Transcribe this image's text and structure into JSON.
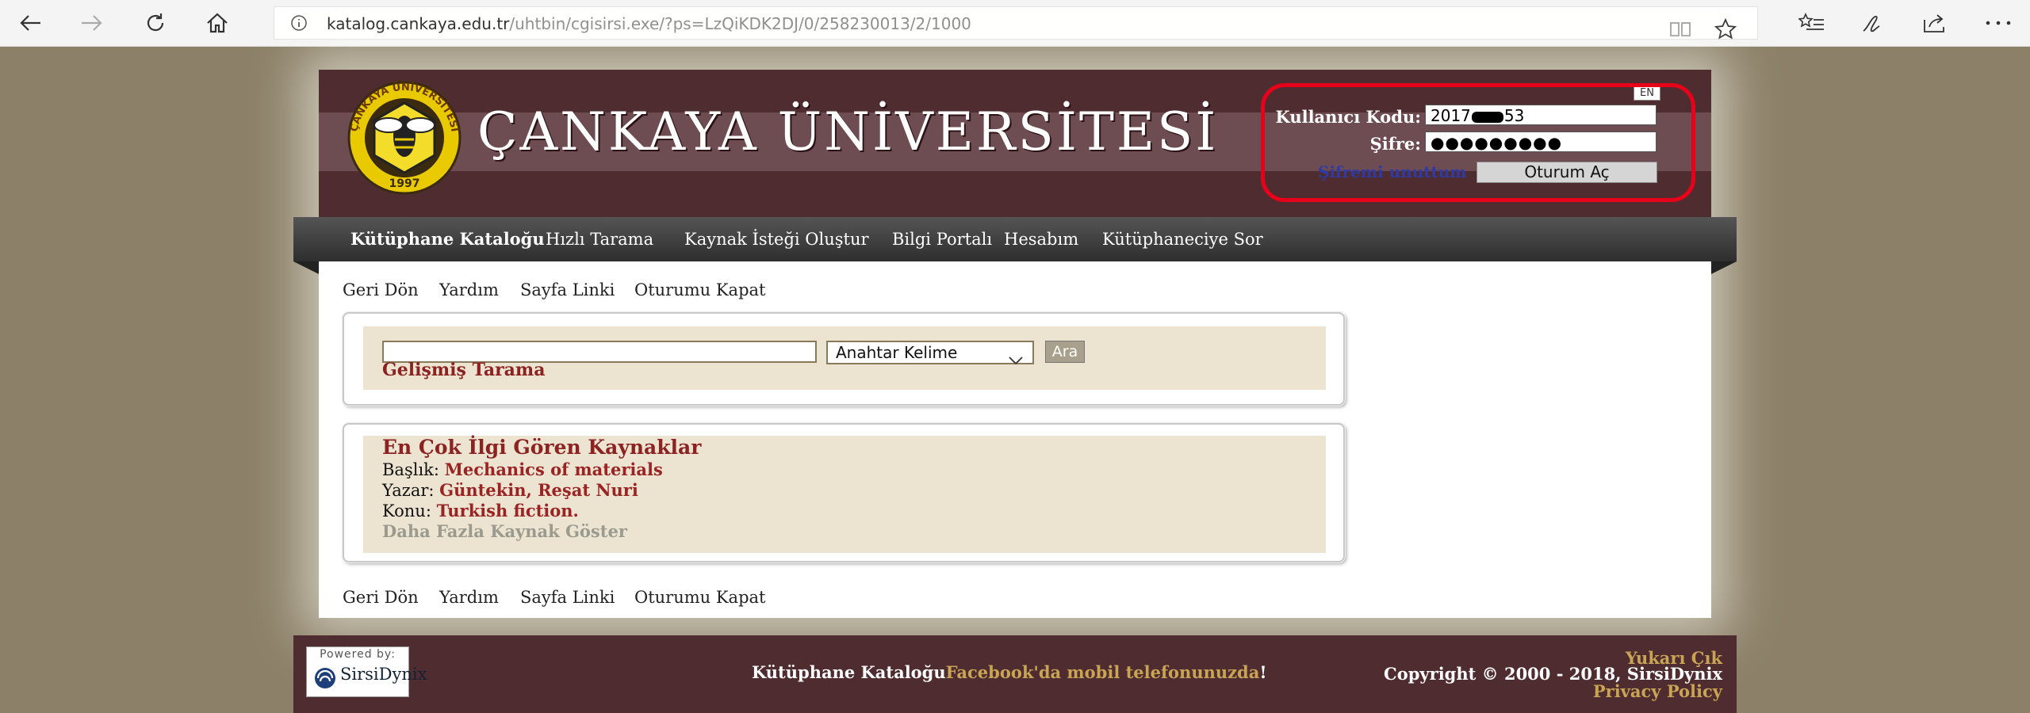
{
  "browser": {
    "url_host": "katalog.cankaya.edu.tr",
    "url_path": "/uhtbin/cgisirsi.exe/?ps=LzQiKDK2DJ/0/258230013/2/1000"
  },
  "header": {
    "title": "ÇANKAYA ÜNİVERSİTESİ",
    "logo_top_text": "ÇANKAYA ÜNİVERSİTESİ",
    "logo_year": "1997",
    "lang_button": "EN",
    "user_label": "Kullanıcı Kodu:",
    "user_value": "2017",
    "user_value_tail": "53",
    "password_label": "Şifre:",
    "password_value": "●●●●●●●●●",
    "forgot_link": "Şifremi unuttum",
    "login_button": "Oturum Aç"
  },
  "nav": {
    "items": [
      "Kütüphane Kataloğu",
      "Hızlı Tarama",
      "Kaynak İsteği Oluştur",
      "Bilgi Portalı",
      "Hesabım",
      "Kütüphaneciye Sor"
    ]
  },
  "toplinks": [
    "Geri Dön",
    "Yardım",
    "Sayfa Linki",
    "Oturumu Kapat"
  ],
  "search": {
    "select_value": "Anahtar Kelime",
    "button": "Ara",
    "advanced": "Gelişmiş Tarama"
  },
  "highlights": {
    "title": "En Çok İlgi Gören Kaynaklar",
    "rows": [
      {
        "label": "Başlık:",
        "value": "Mechanics of materials"
      },
      {
        "label": "Yazar:",
        "value": "Güntekin, Reşat Nuri"
      },
      {
        "label": "Konu:",
        "value": "Turkish fiction."
      }
    ],
    "more": "Daha Fazla Kaynak Göster"
  },
  "footer": {
    "powered_by": "Powered by:",
    "sirsi": "SirsiDynix",
    "catalog_text": "Kütüphane Kataloğu",
    "facebook_text": "Facebook'da mobil telefonunuzda",
    "exclaim": "!",
    "top_link": "Yukarı Çık",
    "copyright": "Copyright © 2000 - 2018, SirsiDynix",
    "privacy": "Privacy Policy"
  },
  "colors": {
    "background": "#8c8068",
    "header": "#4f2c30",
    "accent_red": "#8c2323",
    "panel": "#ece3d0"
  }
}
